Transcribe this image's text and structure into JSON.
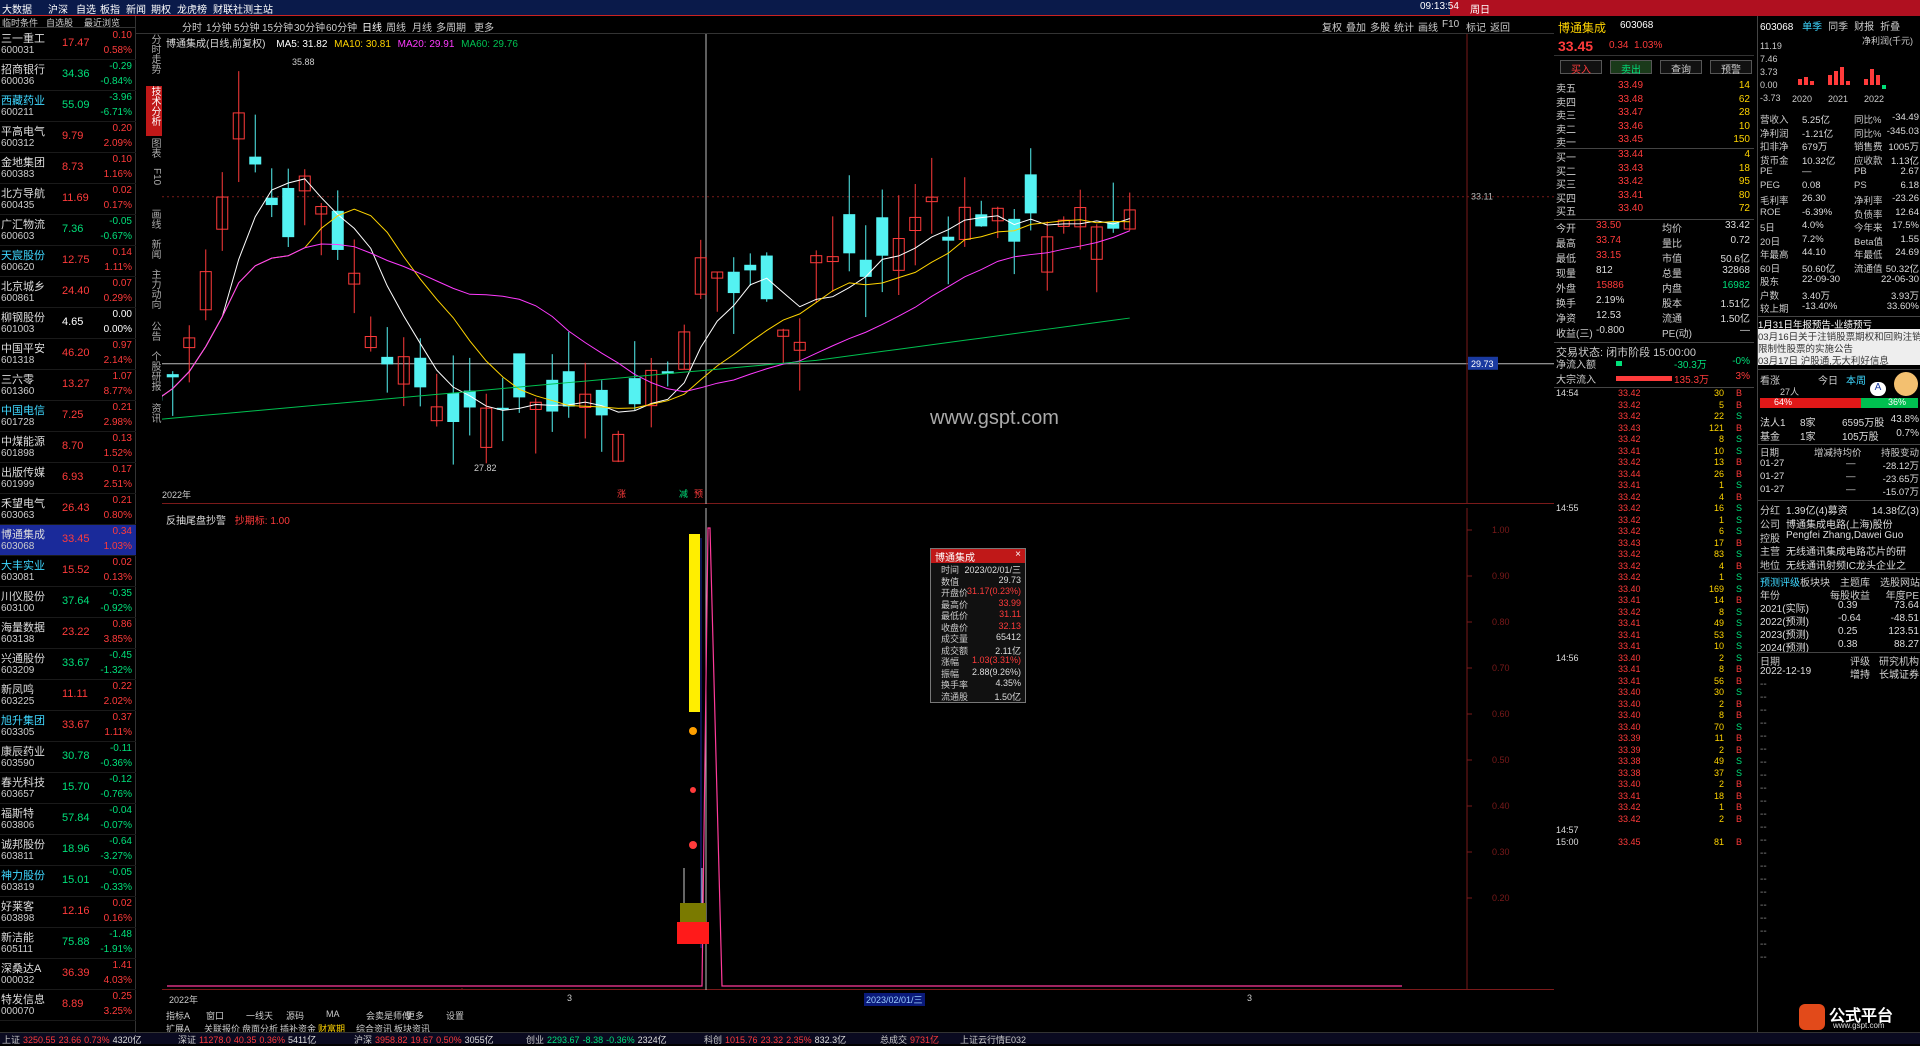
{
  "topbar": {
    "items": [
      "大数据",
      "沪深",
      "自选",
      "板指",
      "新闻",
      "期权",
      "龙虎榜",
      "财联社",
      "测主站"
    ],
    "time": "09:13:54",
    "day": "周日"
  },
  "leftcol": {
    "headers": [
      "临时条件",
      "自选股",
      "最近浏览"
    ],
    "stocks": [
      {
        "name": "三一重工",
        "code": "600031",
        "price": "17.47",
        "chg": "0.10",
        "pct": "0.58%",
        "dir": "up"
      },
      {
        "name": "招商银行",
        "code": "600036",
        "price": "34.36",
        "chg": "-0.29",
        "pct": "-0.84%",
        "dir": "down"
      },
      {
        "name": "西藏药业",
        "code": "600211",
        "price": "55.09",
        "chg": "-3.96",
        "pct": "-6.71%",
        "dir": "down"
      },
      {
        "name": "平高电气",
        "code": "600312",
        "price": "9.79",
        "chg": "0.20",
        "pct": "2.09%",
        "dir": "up"
      },
      {
        "name": "金地集团",
        "code": "600383",
        "price": "8.73",
        "chg": "0.10",
        "pct": "1.16%",
        "dir": "up"
      },
      {
        "name": "北方导航",
        "code": "600435",
        "price": "11.69",
        "chg": "0.02",
        "pct": "0.17%",
        "dir": "up"
      },
      {
        "name": "广汇物流",
        "code": "600603",
        "price": "7.36",
        "chg": "-0.05",
        "pct": "-0.67%",
        "dir": "down"
      },
      {
        "name": "天宸股份",
        "code": "600620",
        "price": "12.75",
        "chg": "0.14",
        "pct": "1.11%",
        "dir": "up"
      },
      {
        "name": "北京城乡",
        "code": "600861",
        "price": "24.40",
        "chg": "0.07",
        "pct": "0.29%",
        "dir": "up"
      },
      {
        "name": "柳钢股份",
        "code": "601003",
        "price": "4.65",
        "chg": "0.00",
        "pct": "0.00%",
        "dir": "flat"
      },
      {
        "name": "中国平安",
        "code": "601318",
        "price": "46.20",
        "chg": "0.97",
        "pct": "2.14%",
        "dir": "up"
      },
      {
        "name": "三六零",
        "code": "601360",
        "price": "13.27",
        "chg": "1.07",
        "pct": "8.77%",
        "dir": "up"
      },
      {
        "name": "中国电信",
        "code": "601728",
        "price": "7.25",
        "chg": "0.21",
        "pct": "2.98%",
        "dir": "up"
      },
      {
        "name": "中煤能源",
        "code": "601898",
        "price": "8.70",
        "chg": "0.13",
        "pct": "1.52%",
        "dir": "up"
      },
      {
        "name": "出版传媒",
        "code": "601999",
        "price": "6.93",
        "chg": "0.17",
        "pct": "2.51%",
        "dir": "up"
      },
      {
        "name": "禾望电气",
        "code": "603063",
        "price": "26.43",
        "chg": "0.21",
        "pct": "0.80%",
        "dir": "up"
      },
      {
        "name": "博通集成",
        "code": "603068",
        "price": "33.45",
        "chg": "0.34",
        "pct": "1.03%",
        "dir": "up",
        "selected": true
      },
      {
        "name": "大丰实业",
        "code": "603081",
        "price": "15.52",
        "chg": "0.02",
        "pct": "0.13%",
        "dir": "up"
      },
      {
        "name": "川仪股份",
        "code": "603100",
        "price": "37.64",
        "chg": "-0.35",
        "pct": "-0.92%",
        "dir": "down"
      },
      {
        "name": "海量数据",
        "code": "603138",
        "price": "23.22",
        "chg": "0.86",
        "pct": "3.85%",
        "dir": "up"
      },
      {
        "name": "兴通股份",
        "code": "603209",
        "price": "33.67",
        "chg": "-0.45",
        "pct": "-1.32%",
        "dir": "down"
      },
      {
        "name": "新凤鸣",
        "code": "603225",
        "price": "11.11",
        "chg": "0.22",
        "pct": "2.02%",
        "dir": "up"
      },
      {
        "name": "旭升集团",
        "code": "603305",
        "price": "33.67",
        "chg": "0.37",
        "pct": "1.11%",
        "dir": "up"
      },
      {
        "name": "康辰药业",
        "code": "603590",
        "price": "30.78",
        "chg": "-0.11",
        "pct": "-0.36%",
        "dir": "down"
      },
      {
        "name": "春光科技",
        "code": "603657",
        "price": "15.70",
        "chg": "-0.12",
        "pct": "-0.76%",
        "dir": "down"
      },
      {
        "name": "福斯特",
        "code": "603806",
        "price": "57.84",
        "chg": "-0.04",
        "pct": "-0.07%",
        "dir": "down"
      },
      {
        "name": "诚邦股份",
        "code": "603811",
        "price": "18.96",
        "chg": "-0.64",
        "pct": "-3.27%",
        "dir": "down"
      },
      {
        "name": "神力股份",
        "code": "603819",
        "price": "15.01",
        "chg": "-0.05",
        "pct": "-0.33%",
        "dir": "down"
      },
      {
        "name": "好莱客",
        "code": "603898",
        "price": "12.16",
        "chg": "0.02",
        "pct": "0.16%",
        "dir": "up"
      },
      {
        "name": "新洁能",
        "code": "605111",
        "price": "75.88",
        "chg": "-1.48",
        "pct": "-1.91%",
        "dir": "down"
      },
      {
        "name": "深桑达A",
        "code": "000032",
        "price": "36.39",
        "chg": "1.41",
        "pct": "4.03%",
        "dir": "up"
      },
      {
        "name": "特发信息",
        "code": "000070",
        "price": "8.89",
        "chg": "0.25",
        "pct": "3.25%",
        "dir": "up"
      }
    ]
  },
  "periodbar": {
    "items": [
      "分时",
      "1分钟",
      "5分钟",
      "15分钟",
      "30分钟",
      "60分钟",
      "日线",
      "周线",
      "月线",
      "多周期",
      "更多"
    ],
    "right": [
      "复权",
      "叠加",
      "多股",
      "统计",
      "画线",
      "F10",
      "标记",
      "返回"
    ]
  },
  "vtabs": [
    "分时走势",
    "技术分析",
    "图表",
    "F10",
    "画线",
    "新闻",
    "主力动向",
    "公告",
    "个股研报",
    "资讯"
  ],
  "kchart": {
    "title": "博通集成(日线,前复权)",
    "ma5": "MA5: 31.82",
    "ma10": "MA10: 30.81",
    "ma20": "MA20: 29.91",
    "ma60": "MA60: 29.76",
    "high_label": "35.88",
    "low_label": "27.82",
    "date_label": "2022年",
    "price_right": "33.11",
    "cross_price": "29.73",
    "watermark": "www.gspt.com",
    "marks": [
      "涨",
      "减",
      "预"
    ]
  },
  "indicator": {
    "name": "反抽尾盘抄警",
    "param": "抄期标: 1.00",
    "yticks": [
      "1.00",
      "0.90",
      "0.80",
      "0.70",
      "0.60",
      "0.50",
      "0.40",
      "0.30",
      "0.20"
    ]
  },
  "tooltip": {
    "title": "博通集成",
    "rows": [
      {
        "k": "时间",
        "v": "2023/02/01/三"
      },
      {
        "k": "数值",
        "v": "29.73"
      },
      {
        "k": "开盘价",
        "v": "31.17(0.23%)"
      },
      {
        "k": "最高价",
        "v": "33.99"
      },
      {
        "k": "最低价",
        "v": "31.11"
      },
      {
        "k": "收盘价",
        "v": "32.13"
      },
      {
        "k": "成交量",
        "v": "65412"
      },
      {
        "k": "成交额",
        "v": "2.11亿"
      },
      {
        "k": "涨幅",
        "v": "1.03(3.31%)"
      },
      {
        "k": "振幅",
        "v": "2.88(9.26%)"
      },
      {
        "k": "换手率",
        "v": "4.35%"
      },
      {
        "k": "流通股",
        "v": "1.50亿"
      }
    ]
  },
  "xlabels": [
    "2022年",
    "3",
    "2023/02/01/三",
    "3"
  ],
  "bottombar1": [
    "指标A",
    "窗口",
    "一线天",
    "源码",
    "MA",
    "会卖是师傅",
    "更多",
    "设置"
  ],
  "bottombar2": [
    "扩展A",
    "关联报价",
    "盘面分析",
    "插补资金",
    "财富期",
    "综合资讯",
    "板块资讯"
  ],
  "rightpanel": {
    "title": "博通集成",
    "code": "603068",
    "price": "33.45",
    "chg": "0.34",
    "pct": "1.03%",
    "buttons": [
      "买入",
      "卖出",
      "查询",
      "预警"
    ],
    "asks": [
      {
        "l": "卖五",
        "p": "33.49",
        "v": "14"
      },
      {
        "l": "卖四",
        "p": "33.48",
        "v": "62"
      },
      {
        "l": "卖三",
        "p": "33.47",
        "v": "28"
      },
      {
        "l": "卖二",
        "p": "33.46",
        "v": "10"
      },
      {
        "l": "卖一",
        "p": "33.45",
        "v": "150"
      }
    ],
    "bids": [
      {
        "l": "买一",
        "p": "33.44",
        "v": "4"
      },
      {
        "l": "买二",
        "p": "33.43",
        "v": "18"
      },
      {
        "l": "买三",
        "p": "33.42",
        "v": "95"
      },
      {
        "l": "买四",
        "p": "33.41",
        "v": "80"
      },
      {
        "l": "买五",
        "p": "33.40",
        "v": "72"
      }
    ],
    "stats": [
      {
        "a": "今开",
        "b": "33.50",
        "c": "均价",
        "d": "33.42"
      },
      {
        "a": "最高",
        "b": "33.74",
        "c": "量比",
        "d": "0.72"
      },
      {
        "a": "最低",
        "b": "33.15",
        "c": "市值",
        "d": "50.6亿"
      },
      {
        "a": "现量",
        "b": "812",
        "c": "总量",
        "d": "32868"
      },
      {
        "a": "外盘",
        "b": "15886",
        "c": "内盘",
        "d": "16982"
      },
      {
        "a": "换手",
        "b": "2.19%",
        "c": "股本",
        "d": "1.51亿"
      },
      {
        "a": "净资",
        "b": "12.53",
        "c": "流通",
        "d": "1.50亿"
      },
      {
        "a": "收益(三)",
        "b": "-0.800",
        "c": "PE(动)",
        "d": "—"
      }
    ],
    "status": "交易状态: 闭市阶段 15:00:00",
    "netin": [
      {
        "l": "净流入额",
        "v": "-30.3万",
        "p": "-0%"
      },
      {
        "l": "大宗流入",
        "v": "135.3万",
        "p": "3%"
      }
    ],
    "ticks": [
      {
        "t": "14:54",
        "p": "33.42",
        "v": "30",
        "d": "B"
      },
      {
        "t": "",
        "p": "33.42",
        "v": "5",
        "d": "B"
      },
      {
        "t": "",
        "p": "33.42",
        "v": "22",
        "d": "S"
      },
      {
        "t": "",
        "p": "33.43",
        "v": "121",
        "d": "B"
      },
      {
        "t": "",
        "p": "33.42",
        "v": "8",
        "d": "S"
      },
      {
        "t": "",
        "p": "33.41",
        "v": "10",
        "d": "S"
      },
      {
        "t": "",
        "p": "33.42",
        "v": "13",
        "d": "B"
      },
      {
        "t": "",
        "p": "33.44",
        "v": "26",
        "d": "B"
      },
      {
        "t": "",
        "p": "33.41",
        "v": "1",
        "d": "S"
      },
      {
        "t": "",
        "p": "33.42",
        "v": "4",
        "d": "B"
      },
      {
        "t": "14:55",
        "p": "33.42",
        "v": "16",
        "d": "S"
      },
      {
        "t": "",
        "p": "33.42",
        "v": "1",
        "d": "S"
      },
      {
        "t": "",
        "p": "33.42",
        "v": "6",
        "d": "S"
      },
      {
        "t": "",
        "p": "33.43",
        "v": "17",
        "d": "B"
      },
      {
        "t": "",
        "p": "33.42",
        "v": "83",
        "d": "S"
      },
      {
        "t": "",
        "p": "33.42",
        "v": "4",
        "d": "B"
      },
      {
        "t": "",
        "p": "33.42",
        "v": "1",
        "d": "S"
      },
      {
        "t": "",
        "p": "33.40",
        "v": "169",
        "d": "S"
      },
      {
        "t": "",
        "p": "33.41",
        "v": "14",
        "d": "B"
      },
      {
        "t": "",
        "p": "33.42",
        "v": "8",
        "d": "S"
      },
      {
        "t": "",
        "p": "33.41",
        "v": "49",
        "d": "S"
      },
      {
        "t": "",
        "p": "33.41",
        "v": "53",
        "d": "S"
      },
      {
        "t": "",
        "p": "33.41",
        "v": "10",
        "d": "S"
      },
      {
        "t": "14:56",
        "p": "33.40",
        "v": "2",
        "d": "S"
      },
      {
        "t": "",
        "p": "33.41",
        "v": "8",
        "d": "B"
      },
      {
        "t": "",
        "p": "33.41",
        "v": "56",
        "d": "B"
      },
      {
        "t": "",
        "p": "33.40",
        "v": "30",
        "d": "S"
      },
      {
        "t": "",
        "p": "33.40",
        "v": "2",
        "d": "B"
      },
      {
        "t": "",
        "p": "33.40",
        "v": "8",
        "d": "B"
      },
      {
        "t": "",
        "p": "33.40",
        "v": "70",
        "d": "S"
      },
      {
        "t": "",
        "p": "33.39",
        "v": "11",
        "d": "B"
      },
      {
        "t": "",
        "p": "33.39",
        "v": "2",
        "d": "B"
      },
      {
        "t": "",
        "p": "33.38",
        "v": "49",
        "d": "S"
      },
      {
        "t": "",
        "p": "33.38",
        "v": "37",
        "d": "S"
      },
      {
        "t": "",
        "p": "33.40",
        "v": "2",
        "d": "B"
      },
      {
        "t": "",
        "p": "33.41",
        "v": "18",
        "d": "B"
      },
      {
        "t": "",
        "p": "33.42",
        "v": "1",
        "d": "B"
      },
      {
        "t": "",
        "p": "33.42",
        "v": "2",
        "d": "B"
      },
      {
        "t": "14:57",
        "p": "",
        "v": "",
        "d": ""
      },
      {
        "t": "15:00",
        "p": "33.45",
        "v": "81",
        "d": "B"
      }
    ],
    "f10": {
      "head": "603068",
      "tabs": [
        "单季",
        "同季",
        "财报",
        "折叠"
      ],
      "unit": "净利润(千元)",
      "years": [
        "2020",
        "2021",
        "2022"
      ],
      "yticks": [
        "11.19",
        "7.46",
        "3.73",
        "0.00",
        "-3.73"
      ],
      "rows": [
        {
          "a": "营收入",
          "b": "5.25亿",
          "c": "同比%",
          "d": "-34.49"
        },
        {
          "a": "净利润",
          "b": "-1.21亿",
          "c": "同比%",
          "d": "-345.03"
        },
        {
          "a": "扣非净",
          "b": "679万",
          "c": "销售费",
          "d": "1005万"
        },
        {
          "a": "货币金",
          "b": "10.32亿",
          "c": "应收款",
          "d": "1.13亿"
        },
        {
          "a": "PE",
          "b": "—",
          "c": "PB",
          "d": "2.67"
        },
        {
          "a": "PEG",
          "b": "0.08",
          "c": "PS",
          "d": "6.18"
        },
        {
          "a": "毛利率",
          "b": "26.30",
          "c": "净利率",
          "d": "-23.26"
        },
        {
          "a": "ROE",
          "b": "-6.39%",
          "c": "负债率",
          "d": "12.64"
        },
        {
          "a": "5日",
          "b": "4.0%",
          "c": "今年来",
          "d": "17.5%"
        },
        {
          "a": "20日",
          "b": "7.2%",
          "c": "Beta值",
          "d": "1.55"
        },
        {
          "a": "年最高",
          "b": "44.10",
          "c": "年最低",
          "d": "24.69"
        },
        {
          "a": "60日",
          "b": "50.60亿",
          "c": "流通值",
          "d": "50.32亿"
        },
        {
          "a": "股东",
          "b": "22-09-30",
          "c": "",
          "d": "22-06-30"
        },
        {
          "a": "户数",
          "b": "3.40万",
          "c": "",
          "d": "3.93万"
        },
        {
          "a": "较上期",
          "b": "-13.40%",
          "c": "",
          "d": "33.60%"
        }
      ],
      "news": [
        "1月31日年报预告-业绩预亏",
        "03月16日关于注销股票期权和回购注销",
        "限制性股票的实施公告",
        "03月17日 沪股通,无大利好信息"
      ],
      "votes": {
        "label": "看涨",
        "today": "今日",
        "week": "本周",
        "people": "27人",
        "bull": "64%",
        "bear": "36%",
        "a": "A"
      },
      "holders": [
        {
          "a": "法人1",
          "b": "8家",
          "c": "6595万股",
          "d": "43.8%"
        },
        {
          "a": "基金",
          "b": "1家",
          "c": "105万股",
          "d": "0.7%"
        }
      ],
      "flows_head": [
        "日期",
        "增减持均价",
        "持股变动"
      ],
      "flows": [
        {
          "a": "01-27",
          "b": "—",
          "c": "-28.12万"
        },
        {
          "a": "01-27",
          "b": "—",
          "c": "-23.65万"
        },
        {
          "a": "01-27",
          "b": "—",
          "c": "-15.07万"
        }
      ],
      "cap": {
        "a": "分红",
        "b": "1.39亿(4)募资",
        "c": "14.38亿(3)"
      },
      "company": [
        {
          "k": "公司",
          "v": "博通集成电路(上海)股份"
        },
        {
          "k": "控股",
          "v": "Pengfei Zhang,Dawei Guo"
        },
        {
          "k": "主营",
          "v": "无线通讯集成电路芯片的研"
        },
        {
          "k": "地位",
          "v": "无线通讯射频IC龙头企业之"
        }
      ],
      "tags": [
        "预测评级",
        "板块块",
        "主题库",
        "选股网站"
      ],
      "eps_head": [
        "年份",
        "每股收益",
        "年度PE"
      ],
      "eps": [
        {
          "y": "2021(实际)",
          "e": "0.39",
          "p": "73.64"
        },
        {
          "y": "2022(预测)",
          "e": "-0.64",
          "p": "-48.51"
        },
        {
          "y": "2023(预测)",
          "e": "0.25",
          "p": "123.51"
        },
        {
          "y": "2024(预测)",
          "e": "0.38",
          "p": "88.27"
        }
      ],
      "rating_head": [
        "日期",
        "评级",
        "研究机构"
      ],
      "rating": {
        "d": "2022-12-19",
        "r": "增持",
        "i": "长城证券"
      }
    },
    "logo": "公式平台",
    "logo_url": "www.gspt.com"
  },
  "statusbar": [
    {
      "n": "上证",
      "v": "3250.55",
      "c": "23.66",
      "p": "0.73%",
      "a": "4320亿"
    },
    {
      "n": "深证",
      "v": "11278.0",
      "c": "40.35",
      "p": "0.36%",
      "a": "5411亿"
    },
    {
      "n": "沪深",
      "v": "3958.82",
      "c": "19.67",
      "p": "0.50%",
      "a": "3055亿"
    },
    {
      "n": "创业",
      "v": "2293.67",
      "c": "-8.38",
      "p": "-0.36%",
      "a": "2324亿"
    },
    {
      "n": "科创",
      "v": "1015.76",
      "c": "23.32",
      "p": "2.35%",
      "a": "832.3亿"
    },
    {
      "n": "总成交",
      "v": "9731亿",
      "c": "",
      "p": "",
      "a": ""
    },
    {
      "n": "上证云行情E032",
      "v": "",
      "c": "",
      "p": "",
      "a": ""
    }
  ],
  "colors": {
    "up": "#ff3b3b",
    "down": "#00e07a",
    "candle_up": "#ff3b3b",
    "candle_down": "#54f2f2",
    "ma5": "#ffffff",
    "ma10": "#ffd400",
    "ma20": "#ff3bff",
    "ma60": "#00c050"
  }
}
